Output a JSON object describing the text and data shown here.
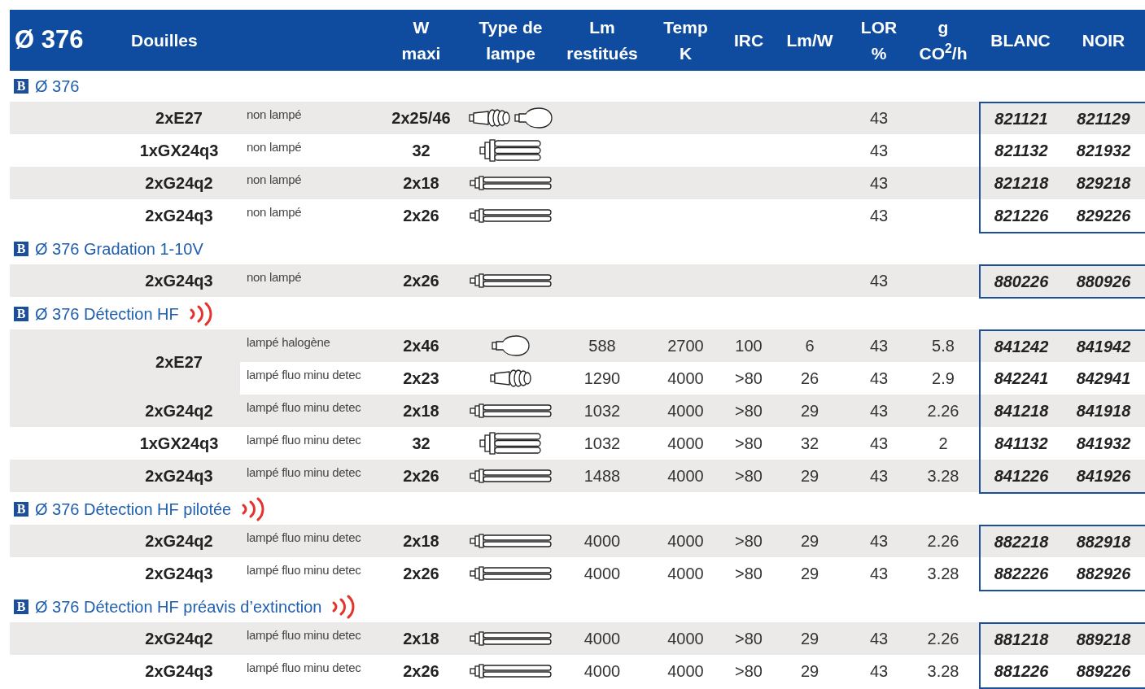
{
  "header": {
    "title": "Ø 376",
    "columns": [
      {
        "lines": [
          "Douilles"
        ]
      },
      {
        "lines": [
          "W",
          "maxi"
        ]
      },
      {
        "lines": [
          "Type de",
          "lampe"
        ]
      },
      {
        "lines": [
          "Lm",
          "restitués"
        ]
      },
      {
        "lines": [
          "Temp",
          "K"
        ]
      },
      {
        "lines": [
          "IRC"
        ]
      },
      {
        "lines": [
          "Lm/W"
        ]
      },
      {
        "lines": [
          "LOR",
          "%"
        ]
      },
      {
        "lines": [
          "g",
          "CO$^{2}$/h"
        ]
      },
      {
        "lines": [
          "BLANC"
        ]
      },
      {
        "lines": [
          "NOIR"
        ]
      }
    ]
  },
  "sections": [
    {
      "badge": "B",
      "title": "Ø 376",
      "detection": false,
      "groups": [
        {
          "douilles": "2xE27",
          "variants": [
            {
              "description": "non lampé",
              "w": "2x25/46",
              "lamps": [
                {
                  "kind": "spiral"
                },
                {
                  "kind": "bulb"
                }
              ],
              "lor": "43",
              "blanc": "821121",
              "noir": "821129"
            }
          ]
        },
        {
          "douilles": "1xGX24q3",
          "variants": [
            {
              "description": "non lampé",
              "w": "32",
              "lamps": [
                {
                  "kind": "quad"
                }
              ],
              "lor": "43",
              "blanc": "821132",
              "noir": "821932"
            }
          ]
        },
        {
          "douilles": "2xG24q2",
          "variants": [
            {
              "description": "non lampé",
              "w": "2x18",
              "lamps": [
                {
                  "kind": "twin"
                }
              ],
              "lor": "43",
              "blanc": "821218",
              "noir": "829218"
            }
          ]
        },
        {
          "douilles": "2xG24q3",
          "variants": [
            {
              "description": "non lampé",
              "w": "2x26",
              "lamps": [
                {
                  "kind": "twin"
                }
              ],
              "lor": "43",
              "blanc": "821226",
              "noir": "829226"
            }
          ]
        }
      ]
    },
    {
      "badge": "B",
      "title": "Ø 376 Gradation 1-10V",
      "detection": false,
      "groups": [
        {
          "douilles": "2xG24q3",
          "variants": [
            {
              "description": "non lampé",
              "w": "2x26",
              "lamps": [
                {
                  "kind": "twin"
                }
              ],
              "lor": "43",
              "blanc": "880226",
              "noir": "880926"
            }
          ]
        }
      ]
    },
    {
      "badge": "B",
      "title": "Ø 376 Détection HF",
      "detection": true,
      "groups": [
        {
          "douilles": "2xE27",
          "variants": [
            {
              "description": "lampé halogène",
              "w": "2x46",
              "lamps": [
                {
                  "kind": "bulb"
                }
              ],
              "lm": "588",
              "temp": "2700",
              "irc": "100",
              "lmw": "6",
              "lor": "43",
              "g": "5.8",
              "blanc": "841242",
              "noir": "841942"
            },
            {
              "description": "lampé fluo minu detec",
              "w": "2x23",
              "lamps": [
                {
                  "kind": "spiral"
                }
              ],
              "lm": "1290",
              "temp": "4000",
              "irc": ">80",
              "lmw": "26",
              "lor": "43",
              "g": "2.9",
              "blanc": "842241",
              "noir": "842941"
            }
          ]
        },
        {
          "douilles": "2xG24q2",
          "variants": [
            {
              "description": "lampé fluo minu detec",
              "w": "2x18",
              "lamps": [
                {
                  "kind": "twin"
                }
              ],
              "lm": "1032",
              "temp": "4000",
              "irc": ">80",
              "lmw": "29",
              "lor": "43",
              "g": "2.26",
              "blanc": "841218",
              "noir": "841918"
            }
          ]
        },
        {
          "douilles": "1xGX24q3",
          "variants": [
            {
              "description": "lampé fluo minu detec",
              "w": "32",
              "lamps": [
                {
                  "kind": "quad"
                }
              ],
              "lm": "1032",
              "temp": "4000",
              "irc": ">80",
              "lmw": "32",
              "lor": "43",
              "g": "2",
              "blanc": "841132",
              "noir": "841932"
            }
          ]
        },
        {
          "douilles": "2xG24q3",
          "variants": [
            {
              "description": "lampé fluo minu detec",
              "w": "2x26",
              "lamps": [
                {
                  "kind": "twin"
                }
              ],
              "lm": "1488",
              "temp": "4000",
              "irc": ">80",
              "lmw": "29",
              "lor": "43",
              "g": "3.28",
              "blanc": "841226",
              "noir": "841926"
            }
          ]
        }
      ]
    },
    {
      "badge": "B",
      "title": "Ø 376 Détection HF pilotée",
      "detection": true,
      "groups": [
        {
          "douilles": "2xG24q2",
          "variants": [
            {
              "description": "lampé fluo minu detec",
              "w": "2x18",
              "lamps": [
                {
                  "kind": "twin"
                }
              ],
              "lm": "4000",
              "temp": "4000",
              "irc": ">80",
              "lmw": "29",
              "lor": "43",
              "g": "2.26",
              "blanc": "882218",
              "noir": "882918"
            }
          ]
        },
        {
          "douilles": "2xG24q3",
          "variants": [
            {
              "description": "lampé fluo minu detec",
              "w": "2x26",
              "lamps": [
                {
                  "kind": "twin"
                }
              ],
              "lm": "4000",
              "temp": "4000",
              "irc": ">80",
              "lmw": "29",
              "lor": "43",
              "g": "3.28",
              "blanc": "882226",
              "noir": "882926"
            }
          ]
        }
      ]
    },
    {
      "badge": "B",
      "title": "Ø 376 Détection HF préavis d’extinction",
      "detection": true,
      "groups": [
        {
          "douilles": "2xG24q2",
          "variants": [
            {
              "description": "lampé fluo minu detec",
              "w": "2x18",
              "lamps": [
                {
                  "kind": "twin"
                }
              ],
              "lm": "4000",
              "temp": "4000",
              "irc": ">80",
              "lmw": "29",
              "lor": "43",
              "g": "2.26",
              "blanc": "881218",
              "noir": "889218"
            }
          ]
        },
        {
          "douilles": "2xG24q3",
          "variants": [
            {
              "description": "lampé fluo minu detec",
              "w": "2x26",
              "lamps": [
                {
                  "kind": "twin"
                }
              ],
              "lm": "4000",
              "temp": "4000",
              "irc": ">80",
              "lmw": "29",
              "lor": "43",
              "g": "3.28",
              "blanc": "881226",
              "noir": "889226"
            }
          ]
        }
      ]
    }
  ]
}
